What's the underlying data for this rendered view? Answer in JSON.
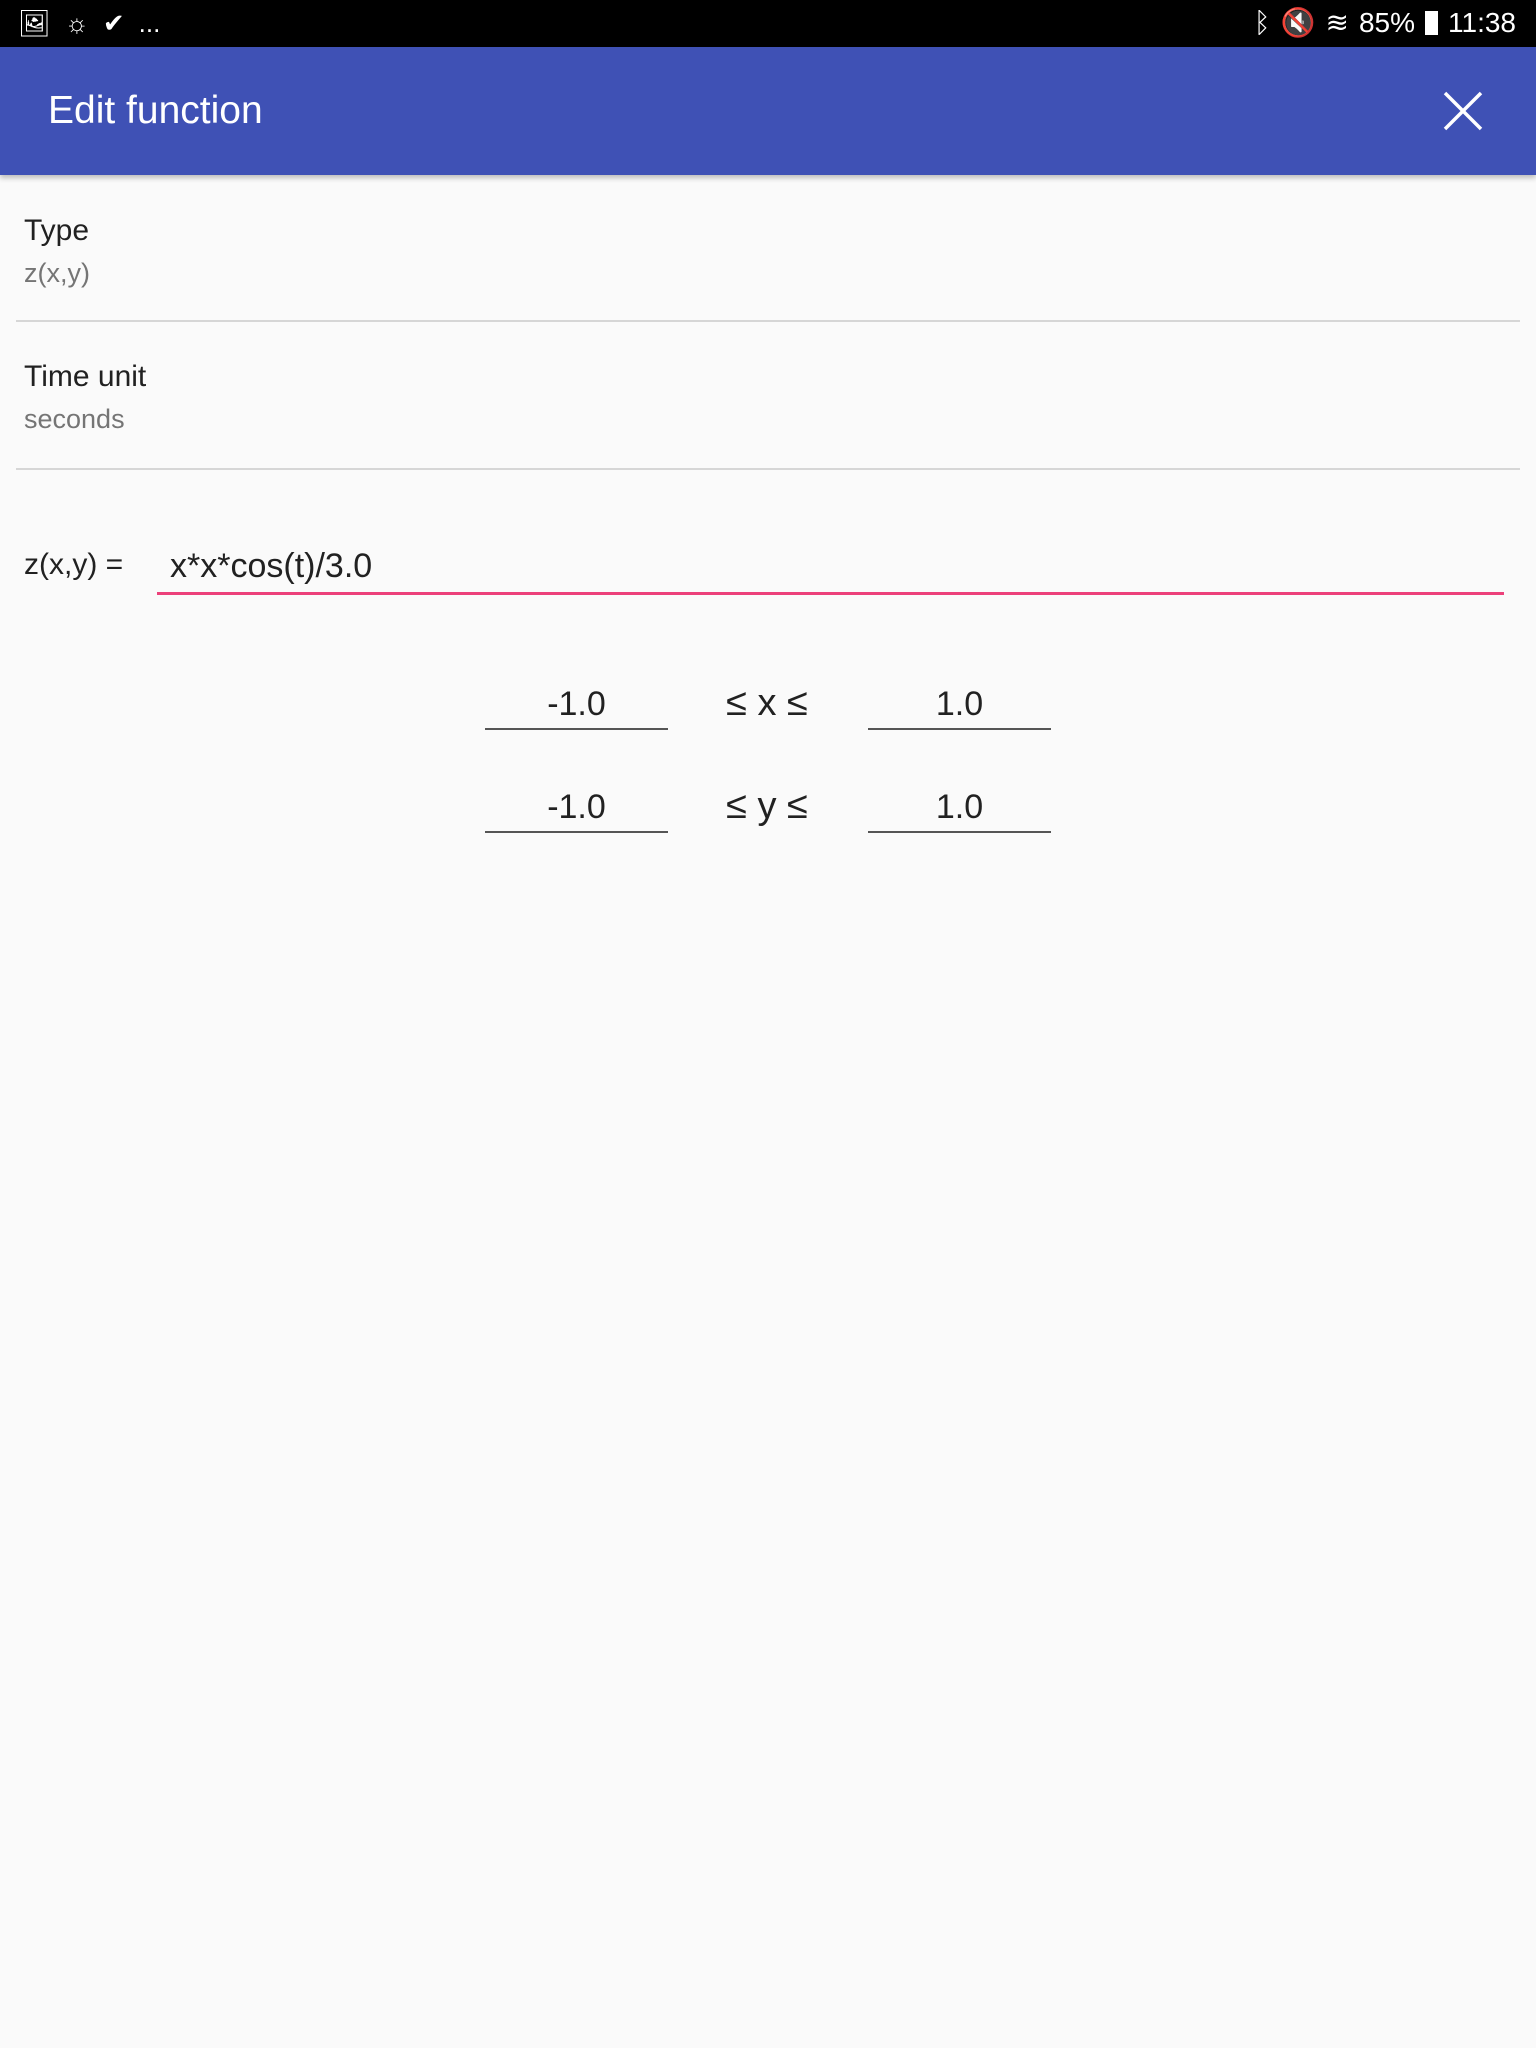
{
  "status_bar": {
    "left_icons": [
      "image-icon",
      "weather-icon",
      "checklist-icon",
      "more-notifications-icon"
    ],
    "more": "...",
    "right_icons": [
      "bluetooth-icon",
      "mute-icon",
      "wifi-icon",
      "battery-icon"
    ],
    "battery": "85%",
    "time": "11:38"
  },
  "app_bar": {
    "title": "Edit function",
    "close_icon": "close-icon",
    "color": "#3f51b5"
  },
  "settings": [
    {
      "label": "Type",
      "value": "z(x,y)"
    },
    {
      "label": "Time unit",
      "value": "seconds"
    }
  ],
  "function": {
    "label": "z(x,y) =",
    "value": "x*x*cos(t)/3.0",
    "accent": "#ec407a"
  },
  "ranges": [
    {
      "min": "-1.0",
      "relation": "≤ x ≤",
      "max": "1.0"
    },
    {
      "min": "-1.0",
      "relation": "≤ y ≤",
      "max": "1.0"
    }
  ]
}
